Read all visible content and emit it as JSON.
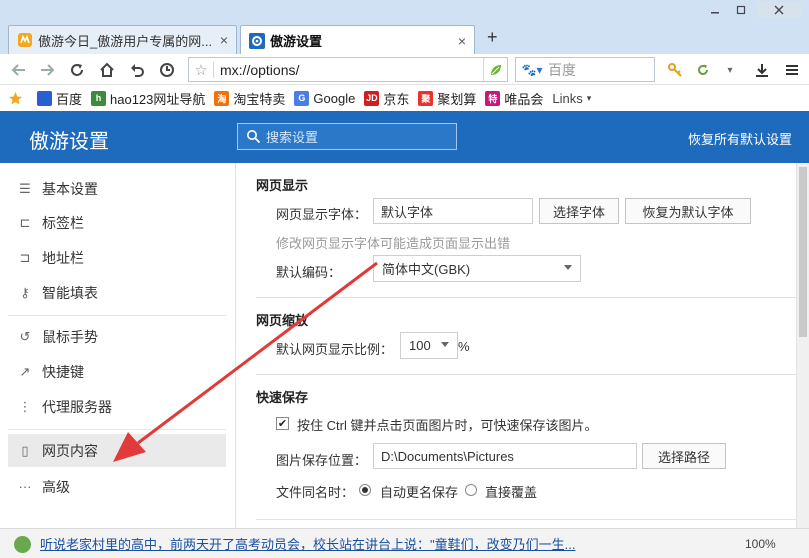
{
  "window": {
    "tabs": [
      {
        "label": "傲游今日_傲游用户专属的网...",
        "close": "×"
      },
      {
        "label": "傲游设置",
        "close": "×"
      }
    ],
    "new_tab": "+",
    "controls": {
      "min": "▭",
      "max": "▭",
      "close": "✕"
    }
  },
  "address_bar": {
    "url": "mx://options/",
    "search_placeholder": "百度"
  },
  "bookmarks": [
    {
      "label": "百度",
      "icon": "baidu-paw-icon",
      "color": "#2d5dd6"
    },
    {
      "label": "hao123网址导航",
      "icon": "hao123-icon",
      "color": "#3b8c3b"
    },
    {
      "label": "淘宝特卖",
      "icon": "taobao-icon",
      "color": "#f0720f"
    },
    {
      "label": "Google",
      "icon": "google-icon",
      "color": "#4a7ee6"
    },
    {
      "label": "京东",
      "icon": "jd-icon",
      "color": "#d01d1d"
    },
    {
      "label": "聚划算",
      "icon": "juhuasuan-icon",
      "color": "#e8332d"
    },
    {
      "label": "唯品会",
      "icon": "vip-icon",
      "color": "#c8167a"
    },
    {
      "label": "Links",
      "icon": "chevron-down-icon",
      "color": "#666666"
    }
  ],
  "header": {
    "title": "傲游设置",
    "search_placeholder": "搜索设置",
    "reset_label": "恢复所有默认设置",
    "color": "#1e6bbd"
  },
  "sidebar": {
    "items": [
      {
        "label": "基本设置",
        "icon": "sliders-icon"
      },
      {
        "label": "标签栏",
        "icon": "tab-icon"
      },
      {
        "label": "地址栏",
        "icon": "address-icon"
      },
      {
        "label": "智能填表",
        "icon": "key-icon"
      },
      {
        "label": "鼠标手势",
        "icon": "gesture-icon"
      },
      {
        "label": "快捷键",
        "icon": "shortcut-icon"
      },
      {
        "label": "代理服务器",
        "icon": "proxy-icon"
      },
      {
        "label": "网页内容",
        "icon": "page-icon",
        "selected": true
      },
      {
        "label": "高级",
        "icon": "more-icon"
      }
    ]
  },
  "content": {
    "web_display": {
      "title": "网页显示",
      "font_label": "网页显示字体：",
      "font_value": "默认字体",
      "choose_font": "选择字体",
      "restore_font": "恢复为默认字体",
      "font_hint": "修改网页显示字体可能造成页面显示出错",
      "encoding_label": "默认编码：",
      "encoding_value": "简体中文(GBK)"
    },
    "zoom": {
      "title": "网页缩放",
      "label": "默认网页显示比例：",
      "value": "100",
      "unit": "%"
    },
    "quick_save": {
      "title": "快速保存",
      "checkbox_label": "按住 Ctrl 键并点击页面图片时，可快速保存该图片。",
      "checked": true,
      "path_label": "图片保存位置：",
      "path_value": "D:\\Documents\\Pictures",
      "choose_path": "选择路径",
      "same_name_label": "文件同名时：",
      "option_rename": "自动更名保存",
      "option_overwrite": "直接覆盖"
    }
  },
  "statusbar": {
    "news": "听说老家村里的高中，前两天开了高考动员会，校长站在讲台上说：\"童鞋们，改变乃们一生...",
    "zoom": "100%"
  },
  "annotation": {
    "arrow_color": "#e03a3a"
  }
}
